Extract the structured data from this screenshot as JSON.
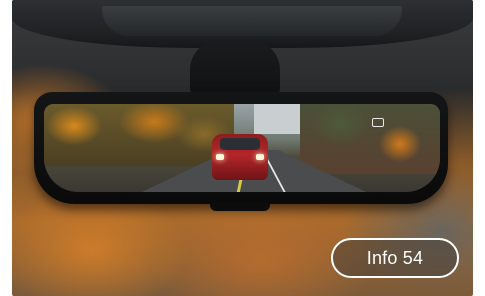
{
  "image": {
    "subject": "rearview-camera-mirror-display",
    "accent_color": "#c0392b"
  },
  "badge": {
    "label": "Info 54"
  },
  "mirror": {
    "icon": "mirror-toggle-icon"
  }
}
